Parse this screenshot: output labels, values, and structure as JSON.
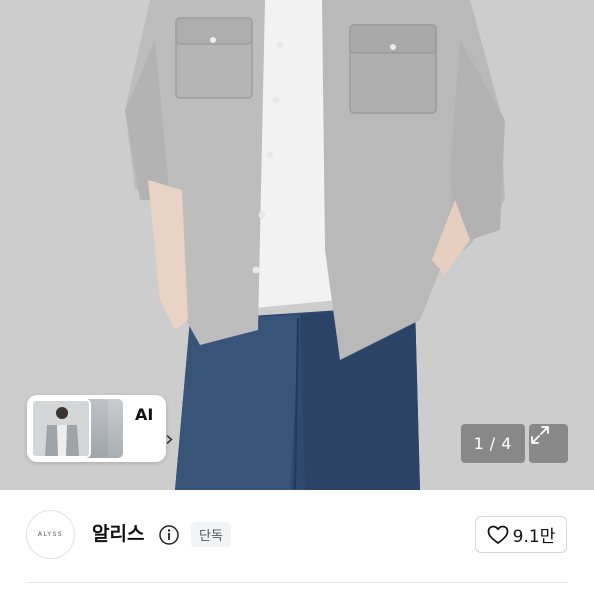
{
  "hero": {
    "ai_card": {
      "label": "AI",
      "chevron_icon": "chevron-right-icon"
    },
    "pager": {
      "current": "1",
      "separator": "/",
      "total": "4"
    },
    "expand_icon": "expand-icon"
  },
  "store": {
    "logo_text": "ALYSS",
    "name": "알리스",
    "info_icon": "info-icon",
    "badge": "단독",
    "like": {
      "icon": "heart-icon",
      "count": "9.1만"
    }
  }
}
